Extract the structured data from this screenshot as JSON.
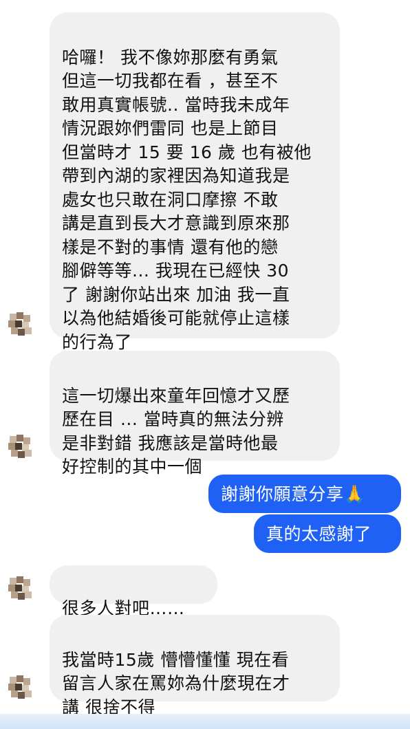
{
  "messages": {
    "m1": "哈囉！ 我不像妳那麼有勇氣\n但這一切我都在看 ，甚至不\n敢用真實帳號.. 當時我未成年\n情況跟妳們雷同 也是上節目\n但當時才 15 要 16 歲 也有被他\n帶到內湖的家裡因為知道我是\n處女也只敢在洞口摩擦 不敢\n講是直到長大才意識到原來那\n樣是不對的事情 還有他的戀\n腳僻等等... 我現在已經快 30\n了 謝謝你站出來 加油 我一直\n以為他結婚後可能就停止這樣\n的行為了",
    "m2": "這一切爆出來童年回憶才又歷\n歷在目 ... 當時真的無法分辨\n是非對錯 我應該是當時他最\n好控制的其中一個",
    "m3": "謝謝你願意分享🙏",
    "m4": "真的太感謝了",
    "m5": "很多人對吧……",
    "m6": "我當時15歲 懵懵懂懂 現在看\n留言人家在罵妳為什麼現在才\n講 很捨不得"
  },
  "colors": {
    "incoming_bubble": "#f0f0f0",
    "outgoing_bubble": "#1f61f5",
    "text": "#111111"
  }
}
